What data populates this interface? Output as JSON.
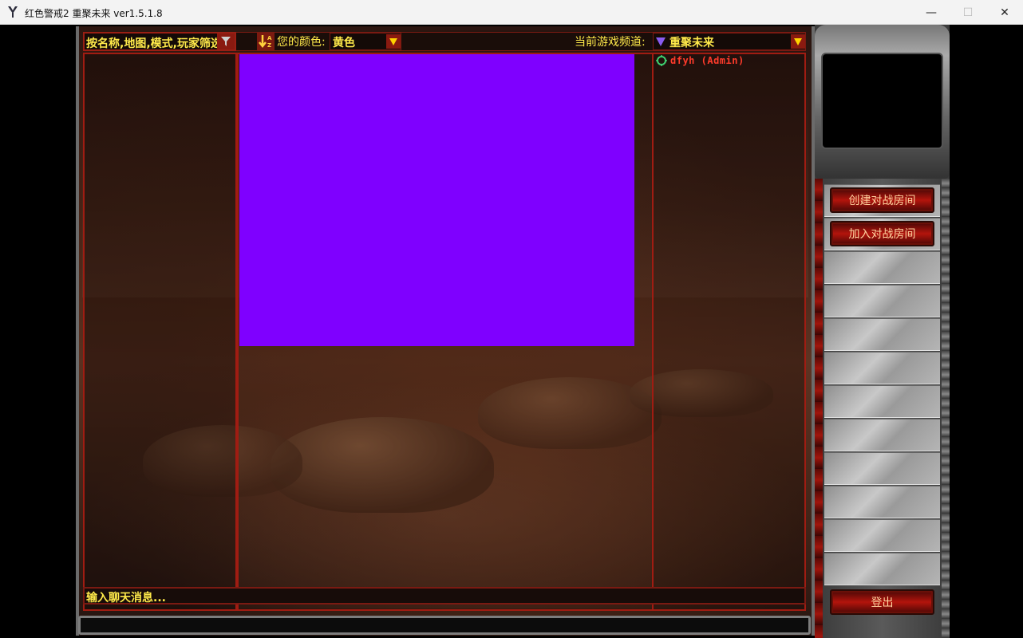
{
  "window": {
    "title": "红色警戒2 重聚未来 ver1.5.1.8",
    "minimize": "—",
    "maximize": "☐",
    "close": "✕"
  },
  "topbar": {
    "filter_placeholder": "按名称,地图,模式,玩家筛选",
    "sort_label": "A↓Z",
    "color_label": "您的颜色:",
    "color_value": "黄色",
    "channel_label": "当前游戏频道:",
    "channel_value": "重聚未来"
  },
  "players": [
    {
      "name": "dfyh (Admin)"
    }
  ],
  "chat": {
    "placeholder": "输入聊天消息..."
  },
  "side": {
    "create_room": "创建对战房间",
    "join_room": "加入对战房间",
    "logout": "登出"
  },
  "colors": {
    "accent_yellow": "#ffea4a",
    "border_red": "#a01c12",
    "purple_area": "#7f00ff",
    "admin_name": "#ff3b2b"
  },
  "icons": {
    "filter": "funnel-icon",
    "sort": "sort-az-icon",
    "dropdown": "triangle-down-icon",
    "channel": "channel-icon",
    "user_status": "target-icon"
  }
}
